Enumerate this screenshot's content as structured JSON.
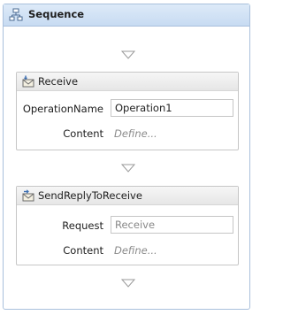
{
  "sequence": {
    "title": "Sequence",
    "icon": "sequence-icon"
  },
  "receive": {
    "title": "Receive",
    "icon": "envelope-in-icon",
    "operation_label": "OperationName",
    "operation_value": "Operation1",
    "content_label": "Content",
    "content_link": "Define..."
  },
  "send_reply": {
    "title": "SendReplyToReceive",
    "icon": "envelope-out-icon",
    "request_label": "Request",
    "request_value": "Receive",
    "content_label": "Content",
    "content_link": "Define..."
  },
  "colors": {
    "sequence_border": "#a9c0dc",
    "sequence_header": "#c7dbf2",
    "activity_border": "#c6c6c6",
    "activity_header": "#e6e6e6",
    "placeholder_text": "#8a8a8a"
  }
}
